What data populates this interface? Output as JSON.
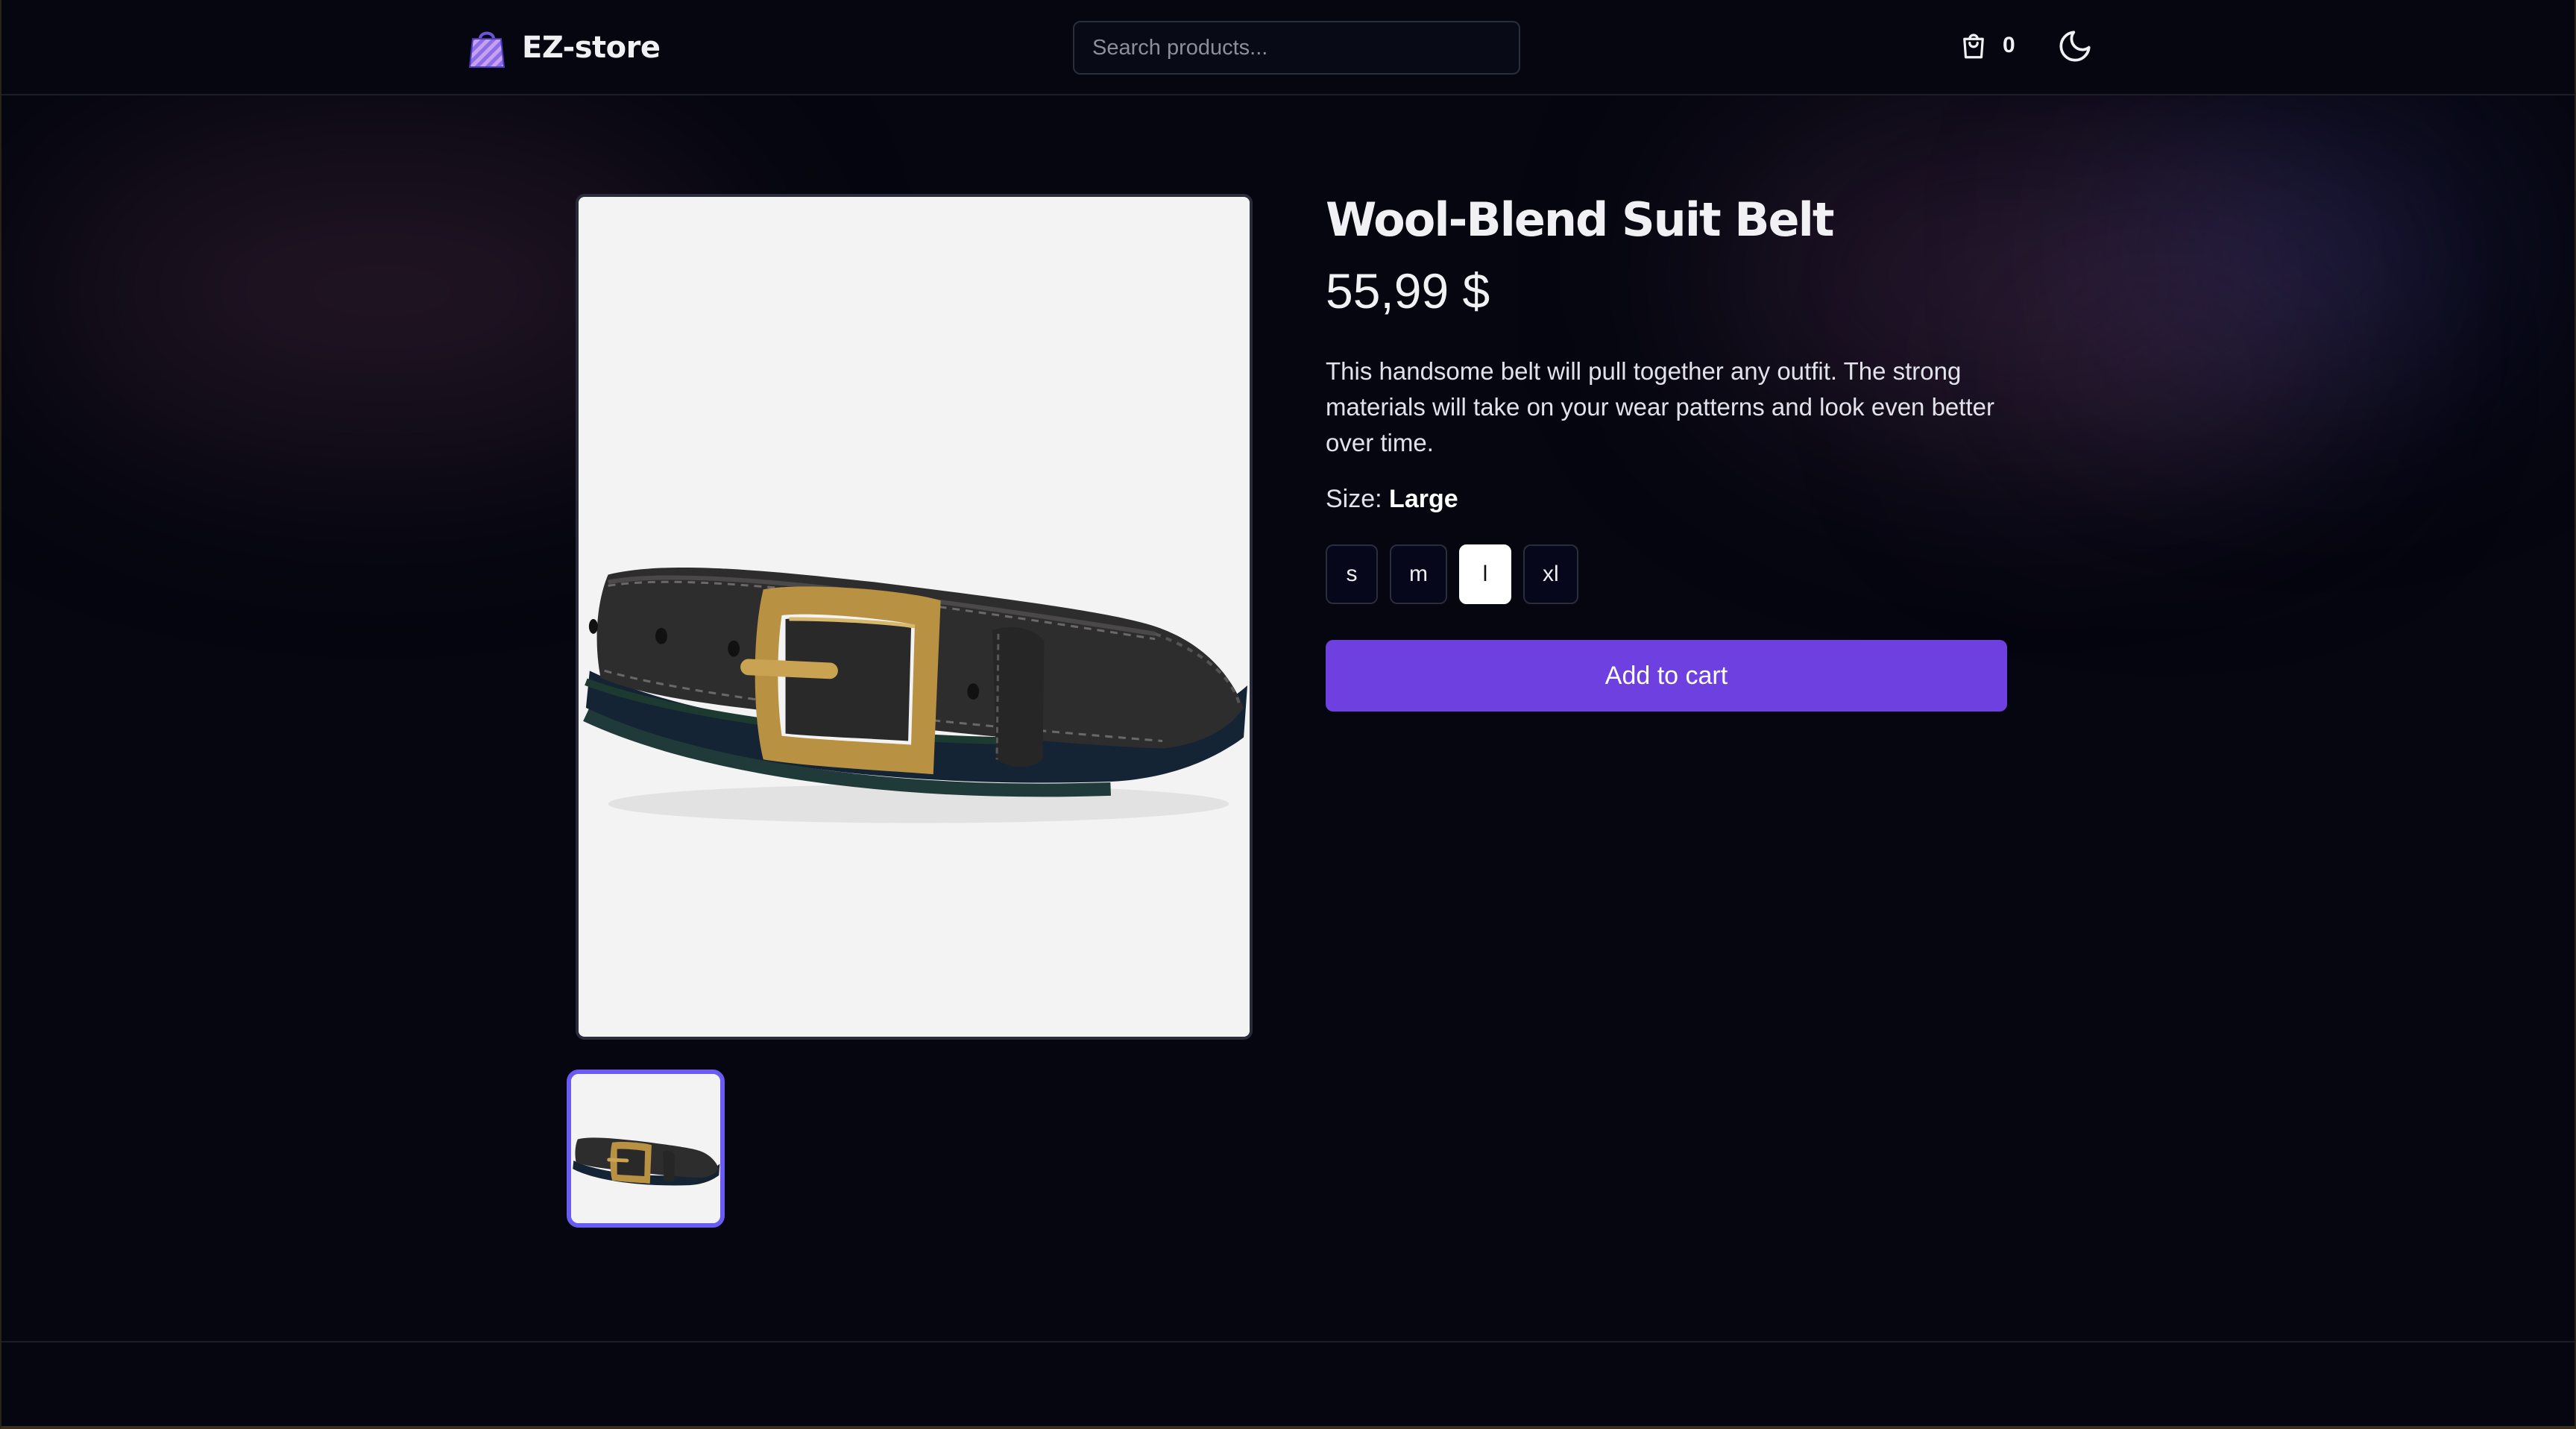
{
  "header": {
    "brand_name": "EZ-store",
    "logo_icon": "shopping-bag-icon",
    "search": {
      "placeholder": "Search products...",
      "value": ""
    },
    "cart": {
      "icon": "cart-icon",
      "count": "0"
    },
    "theme_toggle_icon": "moon-icon"
  },
  "product": {
    "title": "Wool-Blend Suit Belt",
    "price": "55,99 $",
    "description": "This handsome belt will pull together any outfit. The strong materials will take on your wear patterns and look even better over time.",
    "size_label": "Size:",
    "selected_size_name": "Large",
    "sizes": [
      {
        "label": "s",
        "selected": false
      },
      {
        "label": "m",
        "selected": false
      },
      {
        "label": "l",
        "selected": true
      },
      {
        "label": "xl",
        "selected": false
      }
    ],
    "add_to_cart_label": "Add to cart",
    "image_subject": "belt-image",
    "thumbnail_count": 1
  },
  "colors": {
    "background": "#05060f",
    "accent_button": "#6e40e0",
    "thumbnail_border": "#6a5cf2",
    "image_background": "#f3f3f3"
  }
}
